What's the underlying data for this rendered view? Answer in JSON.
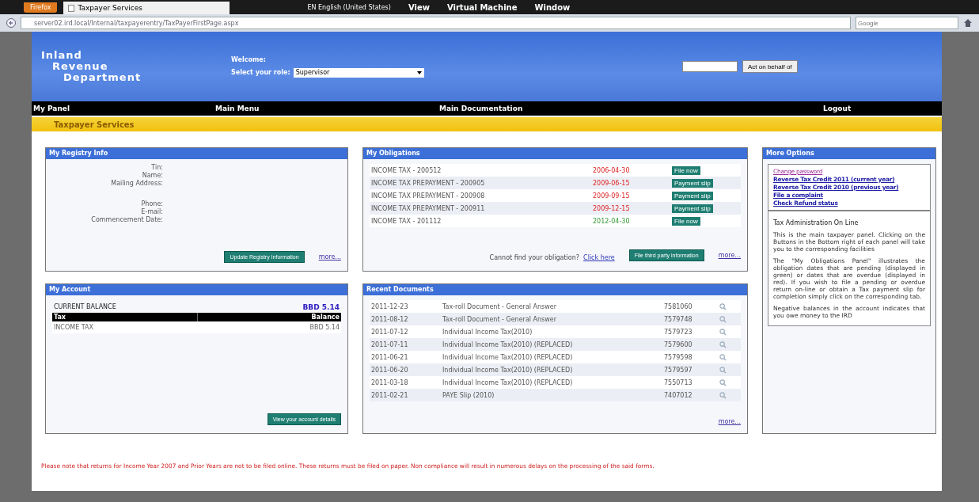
{
  "browser": {
    "menu_button": "Firefox",
    "tab_title": "Taxpayer Services",
    "vm_language": "EN English (United States)",
    "vm_menu": [
      "View",
      "Virtual Machine",
      "Window"
    ],
    "url": "server02.ird.local/Internal/taxpayerentry/TaxPayerFirstPage.aspx",
    "search_placeholder": "Google"
  },
  "header": {
    "logo_lines": [
      "Inland",
      "Revenue",
      "Department"
    ],
    "welcome": "Welcome:",
    "role_label": "Select your role:",
    "role_value": "Supervisor",
    "act_button": "Act on behalf of"
  },
  "nav": [
    "My Panel",
    "Main Menu",
    "Main Documentation",
    "Logout"
  ],
  "page_title": "Taxpayer Services",
  "registry": {
    "title": "My Registry Info",
    "fields": [
      "Tin:",
      "Name:",
      "Mailing Address:",
      "Phone:",
      "E-mail:",
      "Commencement Date:"
    ],
    "button": "Update Registry Information",
    "more": "more..."
  },
  "obligations": {
    "title": "My Obligations",
    "rows": [
      {
        "name": "INCOME TAX - 200512",
        "date": "2006-04-30",
        "overdue": true,
        "action": "File now"
      },
      {
        "name": "INCOME TAX PREPAYMENT - 200905",
        "date": "2009-06-15",
        "overdue": true,
        "action": "Payment slip"
      },
      {
        "name": "INCOME TAX PREPAYMENT - 200908",
        "date": "2009-09-15",
        "overdue": true,
        "action": "Payment slip"
      },
      {
        "name": "INCOME TAX PREPAYMENT - 200911",
        "date": "2009-12-15",
        "overdue": true,
        "action": "Payment slip"
      },
      {
        "name": "INCOME TAX - 201112",
        "date": "2012-04-30",
        "overdue": false,
        "action": "File now"
      }
    ],
    "cannot_find": "Cannot find your obligation?",
    "click_here": "Click here",
    "button": "File third party information",
    "more": "more..."
  },
  "account": {
    "title": "My Account",
    "balance_label": "CURRENT BALANCE",
    "balance_value": "BBD 5.14",
    "columns": [
      "Tax",
      "Balance"
    ],
    "rows": [
      [
        "INCOME TAX",
        "BBD 5.14"
      ]
    ],
    "button": "View your account details"
  },
  "documents": {
    "title": "Recent Documents",
    "rows": [
      [
        "2011-12-23",
        "Tax-roll Document - General Answer",
        "7581060"
      ],
      [
        "2011-08-12",
        "Tax-roll Document - General Answer",
        "7579748"
      ],
      [
        "2011-07-12",
        "Individual Income Tax(2010)",
        "7579723"
      ],
      [
        "2011-07-11",
        "Individual Income Tax(2010) (REPLACED)",
        "7579600"
      ],
      [
        "2011-06-21",
        "Individual Income Tax(2010) (REPLACED)",
        "7579598"
      ],
      [
        "2011-06-20",
        "Individual Income Tax(2010) (REPLACED)",
        "7579597"
      ],
      [
        "2011-03-18",
        "Individual Income Tax(2010) (REPLACED)",
        "7550713"
      ],
      [
        "2011-02-21",
        "PAYE Slip (2010)",
        "7407012"
      ]
    ],
    "more": "more..."
  },
  "options": {
    "title": "More Options",
    "links": [
      {
        "label": "Change password",
        "visited": true
      },
      {
        "label": "Reverse Tax Credit 2011 (current year)",
        "visited": false
      },
      {
        "label": "Reverse Tax Credit 2010 (previous year)",
        "visited": false
      },
      {
        "label": "File a complaint",
        "visited": false
      },
      {
        "label": "Check Refund status",
        "visited": false
      }
    ],
    "info_title": "Tax Administration On Line",
    "paragraphs": [
      "This is the main taxpayer panel. Clicking on the Buttons in the Bottom right of each panel will take you to the corresponding facilities",
      "The \"My Obligations Panel\" illustrates the obligation dates that are pending (displayed in green) or dates that are overdue (displayed in red). If you wish to file a pending or overdue return on-line or obtain a Tax payment slip for completion simply click on the corresponding tab.",
      "Negative balances in the account indicates that you owe money to the IRD"
    ]
  },
  "notice": "Please note that returns for Income Year 2007 and Prior Years are not to be filed online. These returns must be filed on paper. Non compliance will result in numerous delays on the processing of the said forms."
}
